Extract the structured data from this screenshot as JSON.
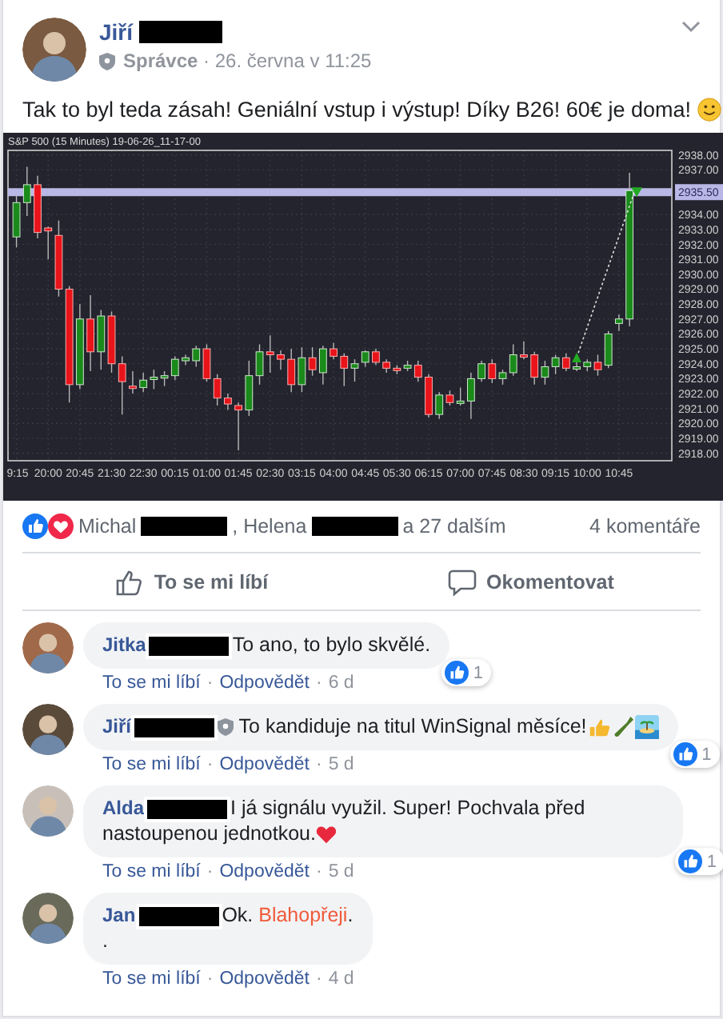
{
  "separator": "·",
  "post": {
    "author": "Jiří",
    "name_redacted": true,
    "meta": "**Správce** · 26. června v 11:25",
    "text": "Tak to byl teda zásah! Geniální vstup i výstup! Díky B26! 60€ je doma!",
    "emoji": {
      "kind": "smile"
    },
    "chart_data": {
      "type": "candlestick",
      "title": "S&P 500 (15 Minutes) 19-06-26_11-17-00",
      "grid": true,
      "ylim": [
        2917.5,
        2938.3
      ],
      "yticks": [
        {
          "value": 2938,
          "label": "2938.00"
        },
        {
          "value": 2937,
          "label": "2937.00"
        },
        {
          "value": 2934,
          "label": "2934.00"
        },
        {
          "value": 2933,
          "label": "2933.00"
        },
        {
          "value": 2932,
          "label": "2932.00"
        },
        {
          "value": 2931,
          "label": "2931.00"
        },
        {
          "value": 2930,
          "label": "2930.00"
        },
        {
          "value": 2929,
          "label": "2929.00"
        },
        {
          "value": 2928,
          "label": "2928.00"
        },
        {
          "value": 2927,
          "label": "2927.00"
        },
        {
          "value": 2926,
          "label": "2926.00"
        },
        {
          "value": 2925,
          "label": "2925.00"
        },
        {
          "value": 2924,
          "label": "2924.00"
        },
        {
          "value": 2923,
          "label": "2923.00"
        },
        {
          "value": 2922,
          "label": "2922.00"
        },
        {
          "value": 2921,
          "label": "2921.00"
        },
        {
          "value": 2920,
          "label": "2920.00"
        },
        {
          "value": 2919,
          "label": "2919.00"
        },
        {
          "value": 2918,
          "label": "2918.00"
        }
      ],
      "ref_lines": [
        {
          "axis": "y",
          "value": 2935.5,
          "label": "2935.50",
          "color": "#b9b7e6"
        }
      ],
      "categories": [
        "9:15",
        null,
        null,
        "20:00",
        null,
        null,
        "20:45",
        null,
        null,
        "21:30",
        null,
        null,
        "22:30",
        null,
        null,
        "00:15",
        null,
        null,
        "01:00",
        null,
        null,
        "01:45",
        null,
        null,
        "02:30",
        null,
        null,
        "03:15",
        null,
        null,
        "04:00",
        null,
        null,
        "04:45",
        null,
        null,
        "05:30",
        null,
        null,
        "06:15",
        null,
        null,
        "07:00",
        null,
        null,
        "07:45",
        null,
        null,
        "08:30",
        null,
        null,
        "09:15",
        null,
        null,
        "10:00",
        null,
        null,
        "10:45",
        null
      ],
      "ohlc": [
        [
          2932.5,
          2935.3,
          2931.8,
          2934.8
        ],
        [
          2934.8,
          2937.2,
          2933.9,
          2936
        ],
        [
          2936,
          2936.6,
          2932.4,
          2932.8
        ],
        [
          2933.1,
          2933.2,
          2931,
          2932.9
        ],
        [
          2932.6,
          2933.6,
          2928.5,
          2929
        ],
        [
          2929,
          2929.2,
          2921.4,
          2922.6
        ],
        [
          2922.6,
          2928,
          2922.3,
          2927
        ],
        [
          2927,
          2928.6,
          2923.5,
          2924.8
        ],
        [
          2924.8,
          2927.6,
          2923.6,
          2927.2
        ],
        [
          2927.2,
          2927.5,
          2923.4,
          2924
        ],
        [
          2924,
          2924.5,
          2920.6,
          2922.8
        ],
        [
          2922.5,
          2923.5,
          2922,
          2922.4
        ],
        [
          2922.4,
          2923.4,
          2922.1,
          2922.9
        ],
        [
          2923,
          2923.6,
          2922.3,
          2923.1
        ],
        [
          2923.2,
          2923.5,
          2922.5,
          2923.2
        ],
        [
          2923.2,
          2924.5,
          2922.9,
          2924.3
        ],
        [
          2924.2,
          2924.6,
          2923.9,
          2924.4
        ],
        [
          2924.2,
          2925.2,
          2923.8,
          2925
        ],
        [
          2925,
          2925.3,
          2922.8,
          2923
        ],
        [
          2923,
          2923.3,
          2921.2,
          2921.7
        ],
        [
          2921.7,
          2922,
          2920.9,
          2921.3
        ],
        [
          2921.2,
          2921.4,
          2918.2,
          2920.9
        ],
        [
          2920.9,
          2924.2,
          2920.5,
          2923.2
        ],
        [
          2923.2,
          2925.3,
          2922.6,
          2924.8
        ],
        [
          2924.8,
          2925.9,
          2923.4,
          2924.6
        ],
        [
          2924.6,
          2924.9,
          2923.6,
          2924.3
        ],
        [
          2924.3,
          2925,
          2922.1,
          2922.6
        ],
        [
          2922.6,
          2925.1,
          2922.1,
          2924.4
        ],
        [
          2924.4,
          2925.1,
          2923.2,
          2923.6
        ],
        [
          2923.4,
          2925.2,
          2922.6,
          2925
        ],
        [
          2925,
          2925.4,
          2924.3,
          2924.5
        ],
        [
          2924.5,
          2924.7,
          2922.5,
          2923.7
        ],
        [
          2923.7,
          2924.3,
          2922.8,
          2924
        ],
        [
          2924.1,
          2924.9,
          2923.8,
          2924.8
        ],
        [
          2924.8,
          2925,
          2923.9,
          2924.1
        ],
        [
          2924.1,
          2924.3,
          2923.4,
          2923.7
        ],
        [
          2923.7,
          2923.9,
          2923.3,
          2923.6
        ],
        [
          2923.7,
          2924.2,
          2923.5,
          2923.9
        ],
        [
          2923.9,
          2924.2,
          2922.8,
          2923.1
        ],
        [
          2923.1,
          2923.3,
          2920.4,
          2920.6
        ],
        [
          2920.6,
          2922.1,
          2920.3,
          2921.9
        ],
        [
          2921.9,
          2922.2,
          2921.2,
          2921.4
        ],
        [
          2921.4,
          2922.4,
          2921.2,
          2921.5
        ],
        [
          2921.5,
          2923.4,
          2920.3,
          2923
        ],
        [
          2923,
          2924.2,
          2922.8,
          2924
        ],
        [
          2924,
          2924.3,
          2922.7,
          2923
        ],
        [
          2923,
          2923.6,
          2922.6,
          2923.4
        ],
        [
          2923.4,
          2925.3,
          2923.2,
          2924.6
        ],
        [
          2924.6,
          2925.5,
          2924.3,
          2924.5
        ],
        [
          2924.6,
          2924.8,
          2922.6,
          2923.1
        ],
        [
          2923.1,
          2924.2,
          2922.6,
          2923.8
        ],
        [
          2923.8,
          2924.6,
          2923.3,
          2924.4
        ],
        [
          2924.4,
          2924.7,
          2923.5,
          2923.7
        ],
        [
          2923.7,
          2924.2,
          2923.5,
          2923.8
        ],
        [
          2923.8,
          2924.3,
          2923.5,
          2924.1
        ],
        [
          2924.1,
          2924.6,
          2923.2,
          2923.6
        ],
        [
          2923.9,
          2926.2,
          2923.7,
          2926
        ],
        [
          2926.7,
          2927.3,
          2926.2,
          2927
        ],
        [
          2927,
          2936.8,
          2926.5,
          2935.6
        ]
      ]
    }
  },
  "reactions": {
    "icons": [
      {
        "kind": "like"
      },
      {
        "kind": "love"
      }
    ],
    "parts": [
      {
        "kind": "text",
        "text": "Michal"
      },
      {
        "kind": "redaction"
      },
      {
        "kind": "text",
        "text": ", Helena"
      },
      {
        "kind": "redaction"
      },
      {
        "kind": "text",
        "text": "a 27 dalším"
      }
    ],
    "comment_count": "4 komentáře"
  },
  "actions": [
    {
      "kind": "like",
      "label": "To se mi líbí"
    },
    {
      "kind": "comment",
      "label": "Okomentovat"
    }
  ],
  "comments": [
    {
      "author": "Jitka",
      "name_redacted": true,
      "admin": false,
      "parts": [
        {
          "kind": "plain",
          "text": "To ano, to bylo skvělé."
        }
      ],
      "reaction_count": "1",
      "actions": [
        "To se mi líbí",
        "Odpovědět"
      ],
      "time": "6 d"
    },
    {
      "author": "Jiří",
      "name_redacted": true,
      "admin": true,
      "parts": [
        {
          "kind": "plain",
          "text": "To kandiduje na titul WinSignal měsíce!"
        }
      ],
      "emojis": [
        {
          "kind": "thumbs-up"
        },
        {
          "kind": "bottle"
        },
        {
          "kind": "island"
        }
      ],
      "reaction_count": "1",
      "actions": [
        "To se mi líbí",
        "Odpovědět"
      ],
      "time": "5 d"
    },
    {
      "author": "Alda",
      "name_redacted": true,
      "admin": false,
      "parts": [
        {
          "kind": "plain",
          "text": "I já signálu využil. Super! Pochvala před nastoupenou jednotkou."
        }
      ],
      "emojis": [
        {
          "kind": "heart"
        }
      ],
      "reaction_count": "1",
      "actions": [
        "To se mi líbí",
        "Odpovědět"
      ],
      "time": "5 d"
    },
    {
      "author": "Jan",
      "name_redacted": true,
      "admin": false,
      "parts": [
        {
          "kind": "plain",
          "text": "Ok. "
        },
        {
          "kind": "highlight",
          "text": "Blahopřeji"
        },
        {
          "kind": "plain",
          "text": ".\n."
        }
      ],
      "actions": [
        "To se mi líbí",
        "Odpovědět"
      ],
      "time": "4 d"
    }
  ]
}
